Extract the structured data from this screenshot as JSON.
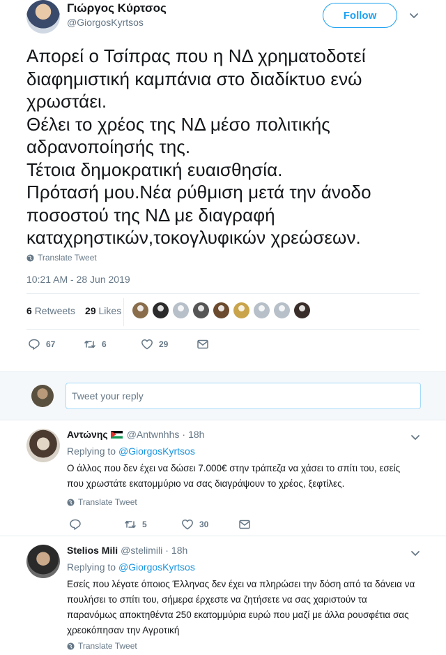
{
  "main_tweet": {
    "author_name": "Γιώργος Κύρτσος",
    "author_handle": "@GiorgosKyrtsos",
    "follow_label": "Follow",
    "text": "Απορεί ο Τσίπρας που η ΝΔ χρηματοδοτεί\nδιαφημιστική καμπάνια στο διαδίκτυο ενώ\nχρωστάει.\nΘέλει το χρέος της ΝΔ μέσο πολιτικής\nαδρανοποίησής της.\nΤέτοια δημοκρατική ευαισθησία.\nΠρότασή μου.Νέα ρύθμιση μετά την άνοδο\nποσοστού της ΝΔ με διαγραφή\nκαταχρηστικών,τοκογλυφικών χρεώσεων.",
    "translate_label": "Translate Tweet",
    "timestamp": "10:21 AM - 28 Jun 2019",
    "retweets_count": "6",
    "retweets_label": "Retweets",
    "likes_count": "29",
    "likes_label": "Likes",
    "actions": {
      "replies": "67",
      "retweets": "6",
      "likes": "29"
    }
  },
  "reply_box": {
    "placeholder": "Tweet your reply"
  },
  "replies": [
    {
      "name": "Αντώνης",
      "handle": "@Antwnhhs",
      "separator": "·",
      "time": "18h",
      "replying_label": "Replying to",
      "replying_to": "@GiorgosKyrtsos",
      "text": "Ο άλλος που δεν έχει να δώσει 7.000€ στην τράπεζα να χάσει το σπίτι του, εσείς που χρωστάτε εκατομμύριο να σας διαγράψουν το χρέος, ξεφτίλες.",
      "translate_label": "Translate Tweet",
      "actions": {
        "replies": "",
        "retweets": "5",
        "likes": "30"
      }
    },
    {
      "name": "Stelios Mili",
      "handle": "@stelimili",
      "separator": "·",
      "time": "18h",
      "replying_label": "Replying to",
      "replying_to": "@GiorgosKyrtsos",
      "text": "Εσείς που λέγατε όποιος Έλληνας δεν έχει να πληρώσει την δόση από τα δάνεια να πουλήσει το σπίτι του, σήμερα έρχεστε να ζητήσετε να σας χαριστούν τα παρανόμως αποκτηθέντα 250 εκατομμύρια ευρώ που μαζί με άλλα ρουσφέτια σας χρεοκόπησαν την Αγροτική",
      "translate_label": "Translate Tweet"
    }
  ],
  "colors": {
    "accent": "#1da1f2",
    "muted": "#657786",
    "text": "#14171a",
    "band": "#f5f8fa"
  }
}
